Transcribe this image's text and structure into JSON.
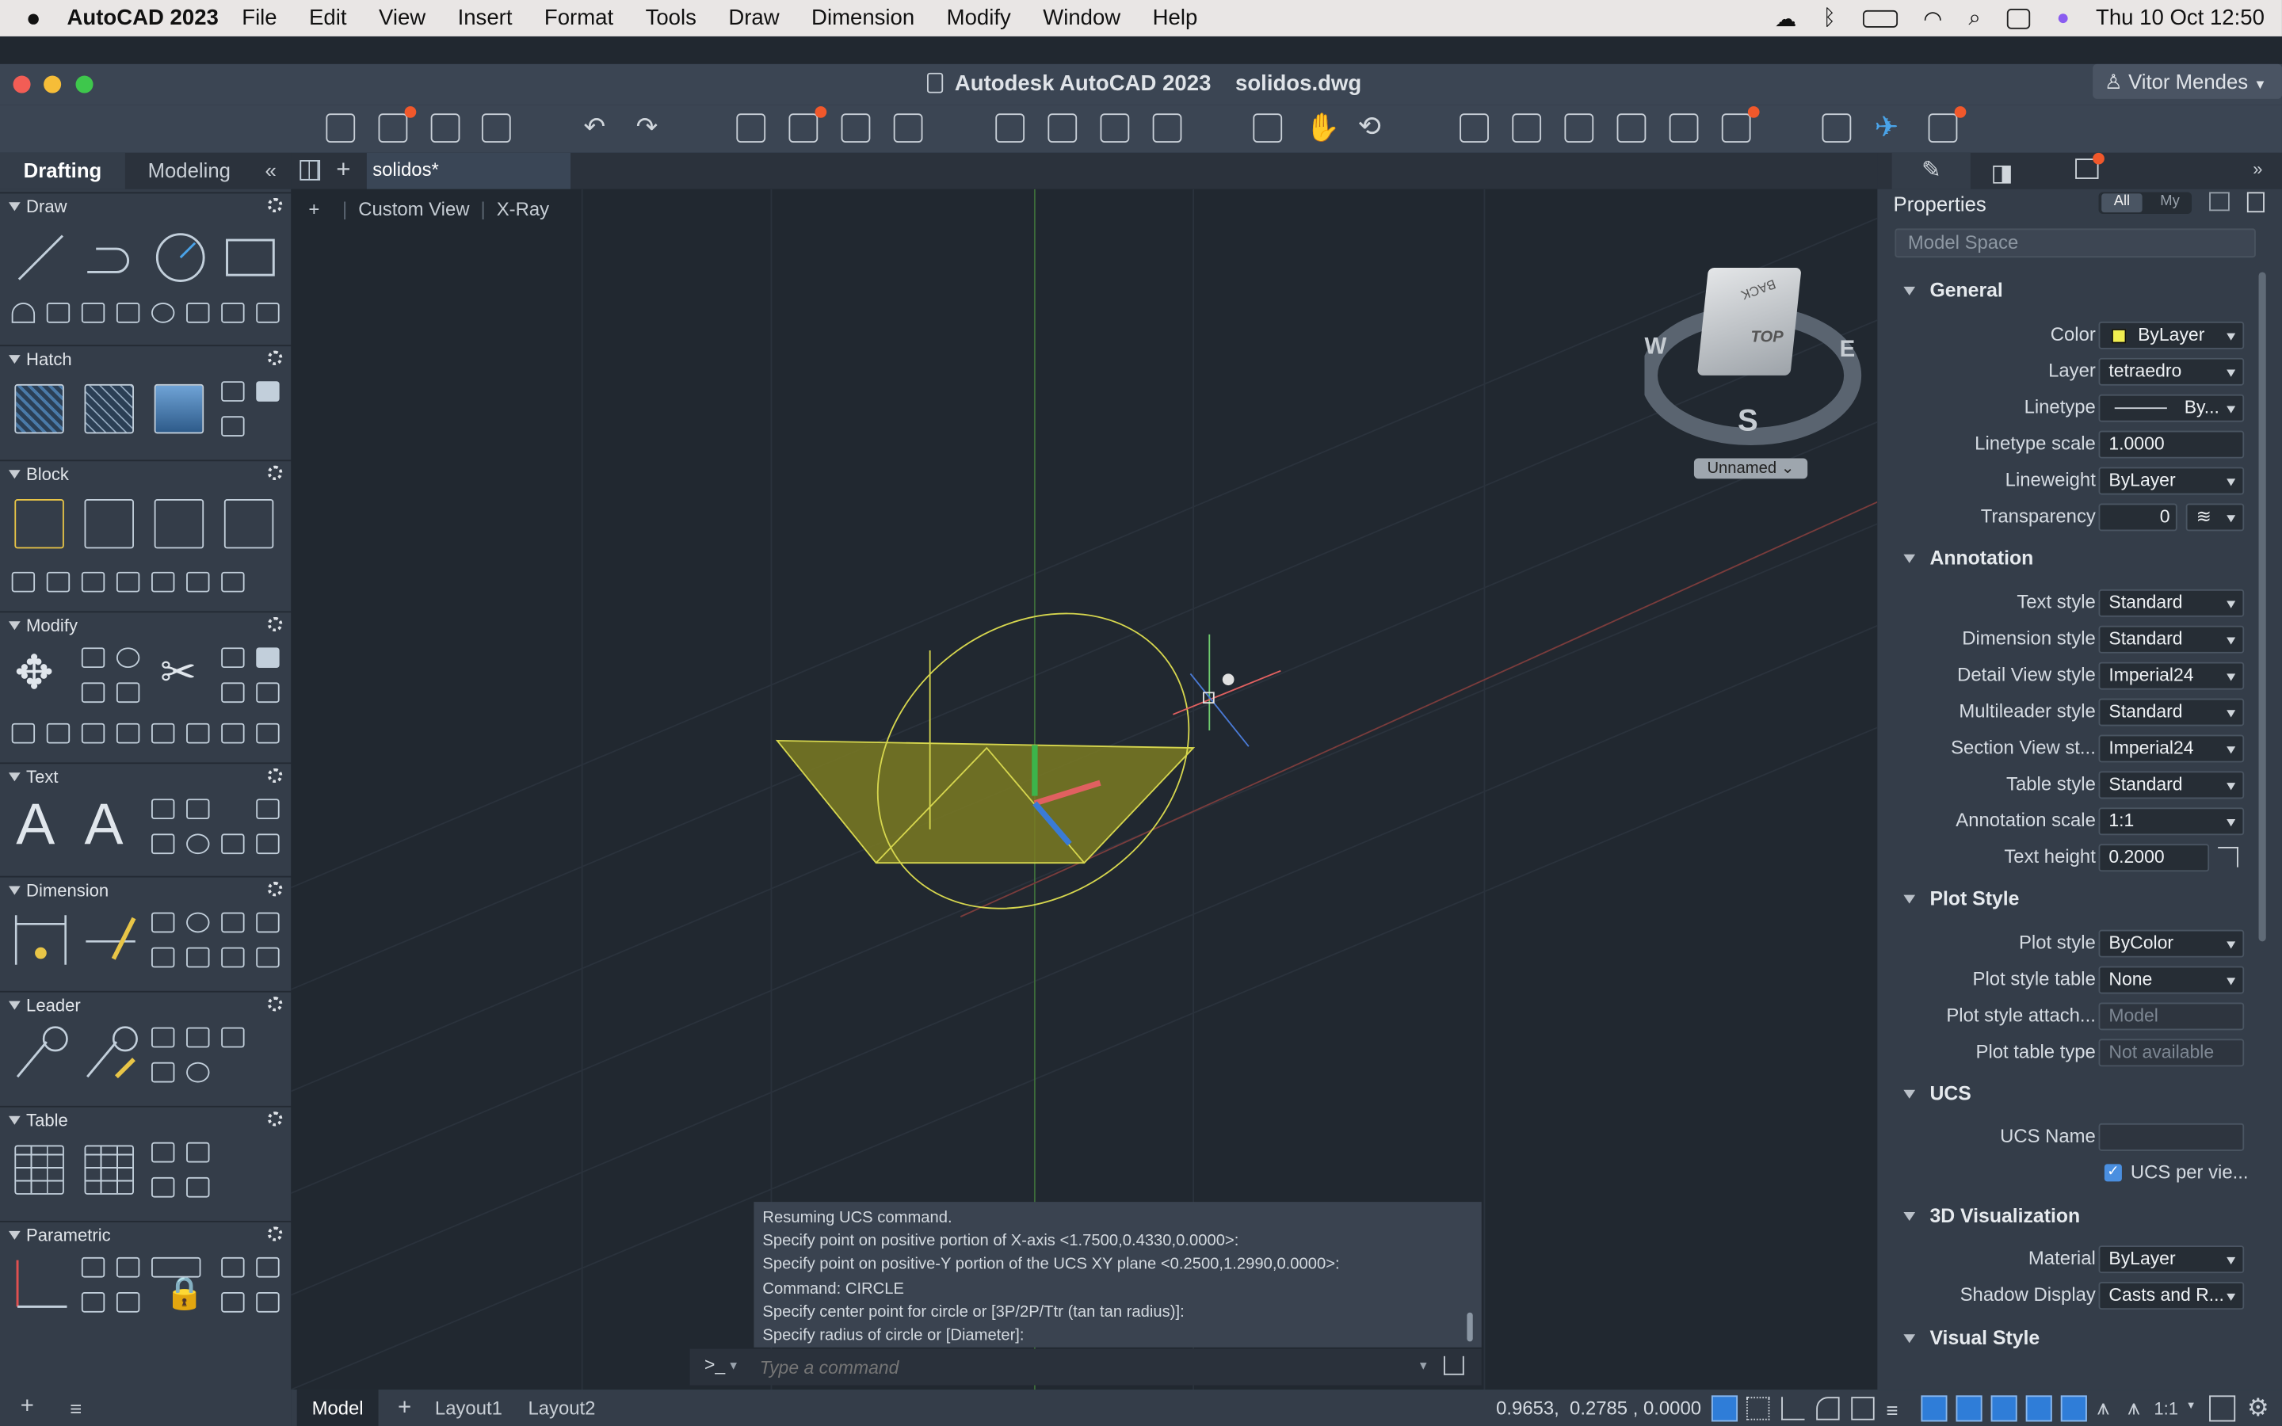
{
  "menubar": {
    "apple": "",
    "app": "AutoCAD 2023",
    "items": [
      "File",
      "Edit",
      "View",
      "Insert",
      "Format",
      "Tools",
      "Draw",
      "Dimension",
      "Modify",
      "Window",
      "Help"
    ],
    "clock": "Thu 10 Oct  12:50"
  },
  "window": {
    "title": "Autodesk AutoCAD 2023    solidos.dwg",
    "user": "Vitor Mendes"
  },
  "left_tabs": {
    "drafting": "Drafting",
    "modeling": "Modeling",
    "collapse": "«"
  },
  "sections": {
    "draw": "Draw",
    "hatch": "Hatch",
    "block": "Block",
    "modify": "Modify",
    "text": "Text",
    "dimension": "Dimension",
    "leader": "Leader",
    "table": "Table",
    "parametric": "Parametric"
  },
  "document": {
    "tab": "solidos*",
    "plus": "+",
    "view_label_plus": "+",
    "view_custom": "Custom View",
    "view_xray": "X-Ray"
  },
  "viewcube": {
    "top": "TOP",
    "back": "BACK",
    "west": "W",
    "east": "E",
    "south": "S",
    "ucs": "Unnamed"
  },
  "command": {
    "history": [
      "Resuming UCS command.",
      "Specify point on positive portion of X-axis <1.7500,0.4330,0.0000>:",
      "Specify point on positive-Y portion of the UCS XY plane <0.2500,1.2990,0.0000>:",
      "Command: CIRCLE",
      "Specify center point for circle or [3P/2P/Ttr (tan tan radius)]:",
      "Specify radius of circle or [Diameter]:"
    ],
    "prompt": ">_",
    "placeholder": "Type a command"
  },
  "layouts": {
    "model": "Model",
    "plus": "+",
    "layout1": "Layout1",
    "layout2": "Layout2"
  },
  "status": {
    "coords": "0.9653,  0.2785 , 0.0000",
    "scale": "1:1"
  },
  "properties": {
    "title": "Properties",
    "filter_all": "All",
    "filter_my": "My",
    "space": "Model Space",
    "general": "General",
    "annotation": "Annotation",
    "plot_style": "Plot Style",
    "ucs": "UCS",
    "visualization": "3D Visualization",
    "visual_style": "Visual Style",
    "rows": {
      "color": {
        "label": "Color",
        "value": "ByLayer"
      },
      "layer": {
        "label": "Layer",
        "value": "tetraedro"
      },
      "linetype": {
        "label": "Linetype",
        "value": "By..."
      },
      "linetype_scale": {
        "label": "Linetype scale",
        "value": "1.0000"
      },
      "lineweight": {
        "label": "Lineweight",
        "value": "ByLayer"
      },
      "transparency": {
        "label": "Transparency",
        "value": "0"
      },
      "text_style": {
        "label": "Text style",
        "value": "Standard"
      },
      "dimension_style": {
        "label": "Dimension style",
        "value": "Standard"
      },
      "detail_view_style": {
        "label": "Detail View style",
        "value": "Imperial24"
      },
      "multileader_style": {
        "label": "Multileader style",
        "value": "Standard"
      },
      "section_view_style": {
        "label": "Section View st...",
        "value": "Imperial24"
      },
      "table_style": {
        "label": "Table style",
        "value": "Standard"
      },
      "annotation_scale": {
        "label": "Annotation scale",
        "value": "1:1"
      },
      "text_height": {
        "label": "Text height",
        "value": "0.2000"
      },
      "plot_style": {
        "label": "Plot style",
        "value": "ByColor"
      },
      "plot_style_table": {
        "label": "Plot style table",
        "value": "None"
      },
      "plot_style_attach": {
        "label": "Plot style attach...",
        "value": "Model"
      },
      "plot_table_type": {
        "label": "Plot table type",
        "value": "Not available"
      },
      "ucs_name": {
        "label": "UCS Name",
        "value": ""
      },
      "ucs_per_view": {
        "label": "UCS per vie..."
      },
      "material": {
        "label": "Material",
        "value": "ByLayer"
      },
      "shadow_display": {
        "label": "Shadow Display",
        "value": "Casts and R..."
      }
    }
  },
  "colors": {
    "accent_orange": "#f1582b",
    "selection_yellow": "#d6d64e",
    "x_axis": "#e06060",
    "y_axis": "#3cb44b",
    "z_axis": "#3a7bd5"
  }
}
